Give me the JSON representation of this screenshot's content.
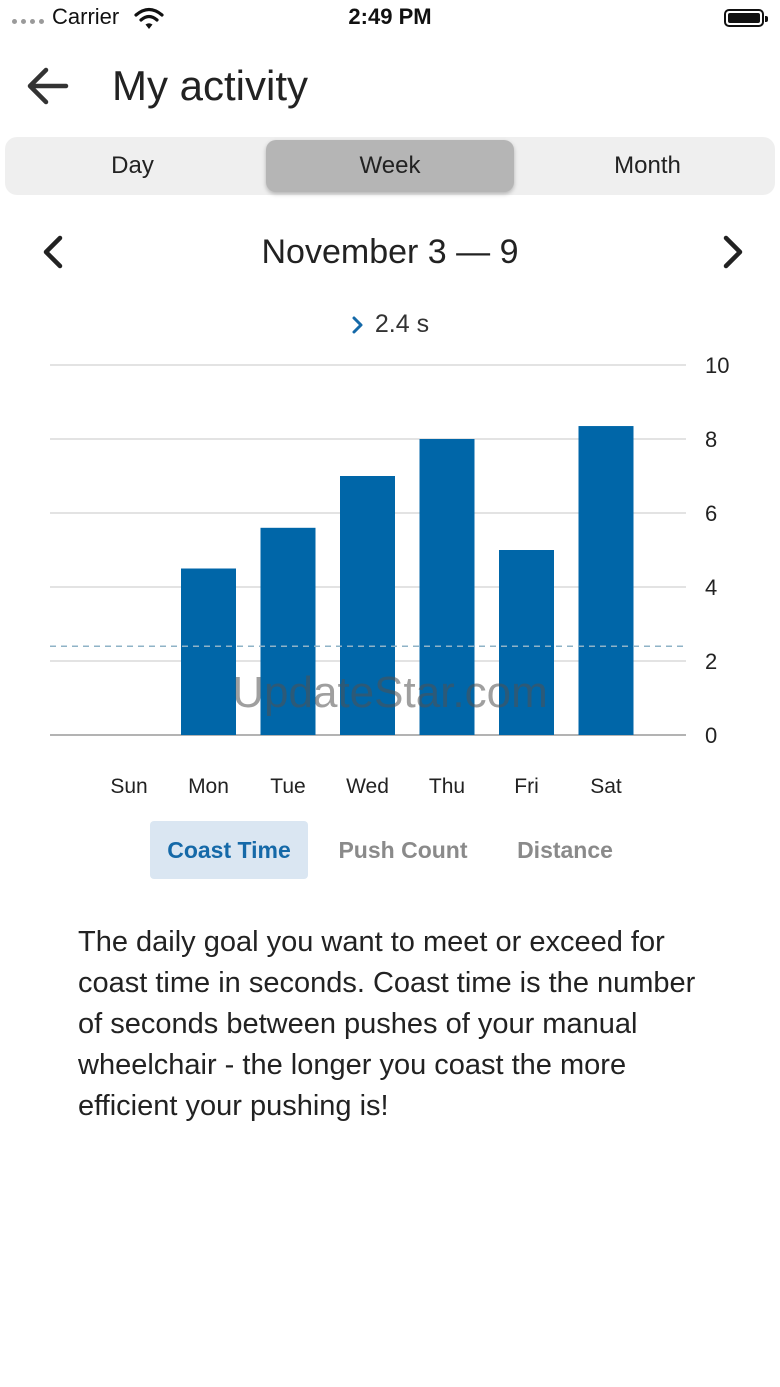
{
  "status_bar": {
    "carrier": "Carrier",
    "time": "2:49 PM"
  },
  "header": {
    "title": "My activity",
    "back_icon": "arrow-left-icon"
  },
  "period_tabs": [
    {
      "label": "Day",
      "selected": false
    },
    {
      "label": "Week",
      "selected": true
    },
    {
      "label": "Month",
      "selected": false
    }
  ],
  "date_nav": {
    "range": "November 3 — 9",
    "prev_icon": "chevron-left-icon",
    "next_icon": "chevron-right-icon"
  },
  "selected_value": "2.4 s",
  "chart_data": {
    "type": "bar",
    "categories": [
      "Sun",
      "Mon",
      "Tue",
      "Wed",
      "Thu",
      "Fri",
      "Sat"
    ],
    "values": [
      0,
      4.5,
      5.6,
      7.0,
      8.0,
      5.0,
      8.35
    ],
    "yticks": [
      "0",
      "2",
      "4",
      "6",
      "8",
      "10"
    ],
    "ylim": [
      0,
      10
    ],
    "goal": 2.4,
    "grid": true,
    "axis_position": "right",
    "bar_color": "#0066a8"
  },
  "watermark": "UpdateStar.com",
  "metric_tabs": [
    {
      "label": "Coast Time",
      "selected": true
    },
    {
      "label": "Push Count",
      "selected": false
    },
    {
      "label": "Distance",
      "selected": false
    }
  ],
  "description": "The daily goal you want to meet or exceed for coast time in seconds. Coast time is the number of seconds between pushes of your manual wheelchair - the longer you coast the more efficient your pushing is!",
  "colors": {
    "accent": "#1569a8",
    "bar": "#0066a8",
    "selected_tab": "#b5b5b5",
    "metric_tab_bg": "#dae6f2"
  }
}
